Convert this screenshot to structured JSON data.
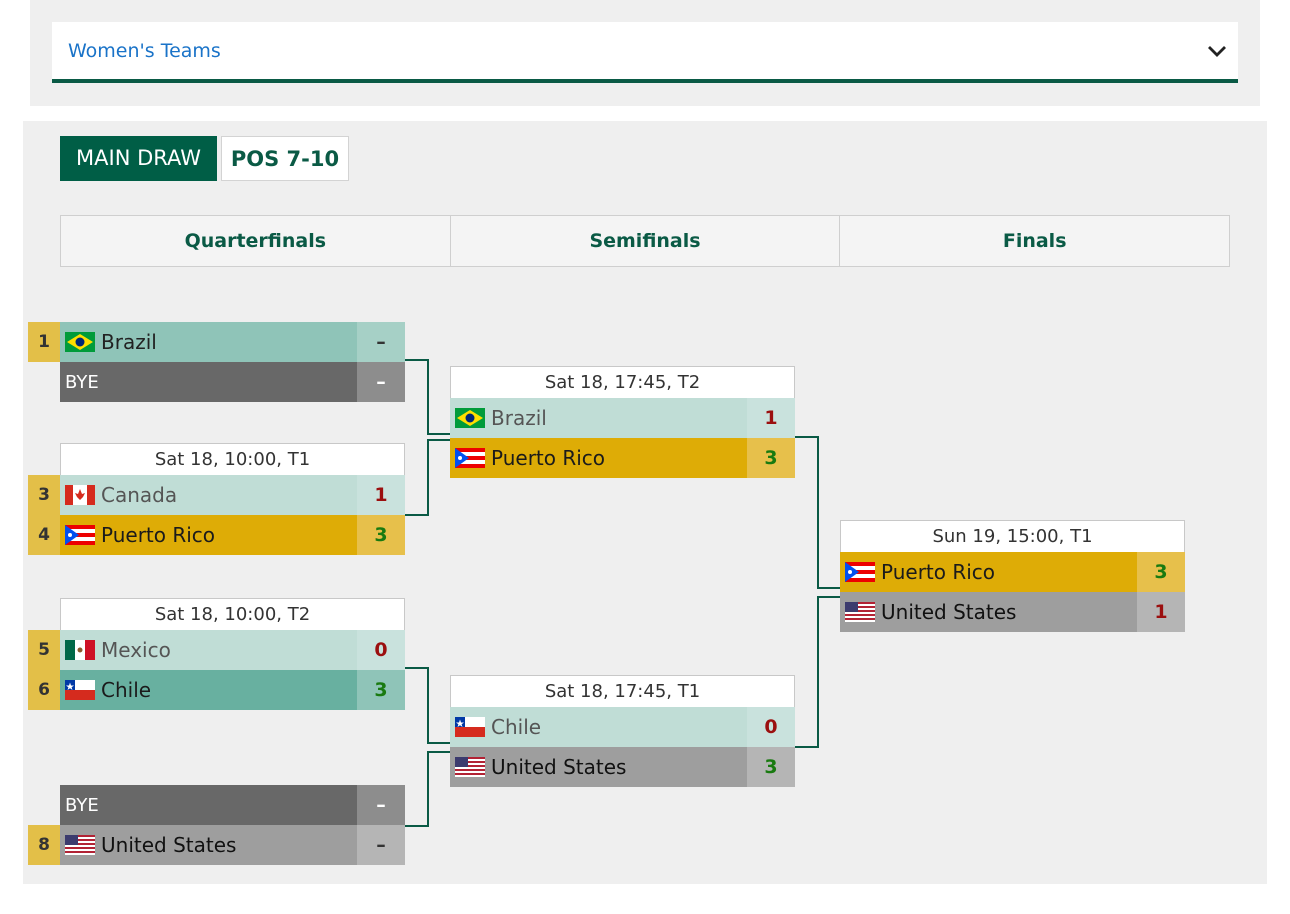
{
  "selector": {
    "label": "Women's Teams",
    "chevron_icon": "chevron-down-icon"
  },
  "tabs": {
    "main": "MAIN DRAW",
    "pos": "POS 7-10"
  },
  "rounds": [
    "Quarterfinals",
    "Semifinals",
    "Finals"
  ],
  "qf": {
    "m1": {
      "seed": "1",
      "team1": "Brazil",
      "score1": "–",
      "team2": "BYE",
      "score2": "–"
    },
    "m2": {
      "header": "Sat 18, 10:00, T1",
      "seed1": "3",
      "team1": "Canada",
      "score1": "1",
      "seed2": "4",
      "team2": "Puerto Rico",
      "score2": "3"
    },
    "m3": {
      "header": "Sat 18, 10:00, T2",
      "seed1": "5",
      "team1": "Mexico",
      "score1": "0",
      "seed2": "6",
      "team2": "Chile",
      "score2": "3"
    },
    "m4": {
      "team1": "BYE",
      "score1": "–",
      "seed2": "8",
      "team2": "United States",
      "score2": "–"
    }
  },
  "sf": {
    "m1": {
      "header": "Sat 18, 17:45, T2",
      "team1": "Brazil",
      "score1": "1",
      "team2": "Puerto Rico",
      "score2": "3"
    },
    "m2": {
      "header": "Sat 18, 17:45, T1",
      "team1": "Chile",
      "score1": "0",
      "team2": "United States",
      "score2": "3"
    }
  },
  "final": {
    "header": "Sun 19, 15:00, T1",
    "team1": "Puerto Rico",
    "score1": "3",
    "team2": "United States",
    "score2": "1"
  },
  "colors": {
    "brand_green": "#005e46",
    "winner_gold": "#deac06",
    "loss_red": "#9b0f0f",
    "win_green": "#197a10"
  }
}
